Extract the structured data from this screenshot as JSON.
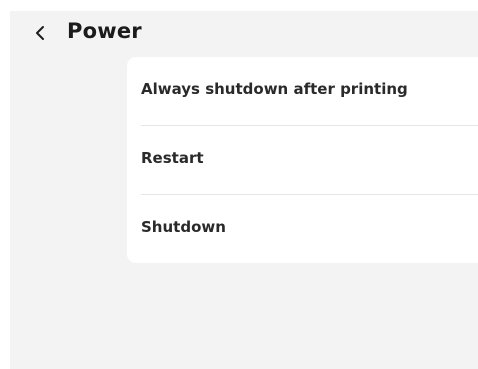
{
  "header": {
    "back_icon": "chevron-left-icon",
    "title": "Power"
  },
  "menu": {
    "items": [
      {
        "label": "Always shutdown after printing"
      },
      {
        "label": "Restart"
      },
      {
        "label": "Shutdown"
      }
    ]
  },
  "colors": {
    "background": "#f3f3f3",
    "card": "#ffffff",
    "text": "#1b1b1b",
    "divider": "#e6e6e6"
  }
}
